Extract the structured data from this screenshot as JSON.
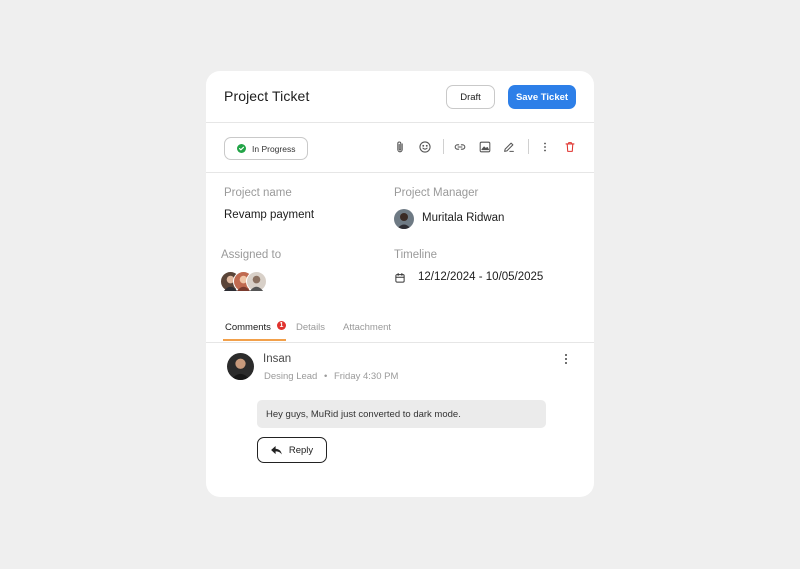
{
  "header": {
    "title": "Project Ticket",
    "draft_label": "Draft",
    "save_label": "Save Ticket"
  },
  "status": {
    "label": "In Progress",
    "color": "#22a447"
  },
  "toolbar": {
    "icons": [
      "paperclip-icon",
      "emoji-icon",
      "link-icon",
      "image-icon",
      "pen-icon",
      "more-vertical-icon",
      "trash-icon"
    ],
    "delete_color": "#e0332e"
  },
  "fields": {
    "project_name": {
      "label": "Project name",
      "value": "Revamp payment"
    },
    "project_manager": {
      "label": "Project Manager",
      "value": "Muritala Ridwan"
    },
    "assigned_to": {
      "label": "Assigned to"
    },
    "timeline": {
      "label": "Timeline",
      "value": "12/12/2024 - 10/05/2025"
    }
  },
  "tabs": [
    {
      "label": "Comments",
      "badge": "1",
      "active": true
    },
    {
      "label": "Details",
      "active": false
    },
    {
      "label": "Attachment",
      "active": false
    }
  ],
  "comment": {
    "author": "Insan",
    "role": "Desing Lead",
    "separator": "•",
    "time": "Friday 4:30 PM",
    "message": "Hey guys, MuRid just converted to dark mode.",
    "reply_label": "Reply"
  },
  "colors": {
    "accent": "#2d7fe8",
    "tab_underline": "#f2a04a",
    "badge": "#e0332e"
  }
}
